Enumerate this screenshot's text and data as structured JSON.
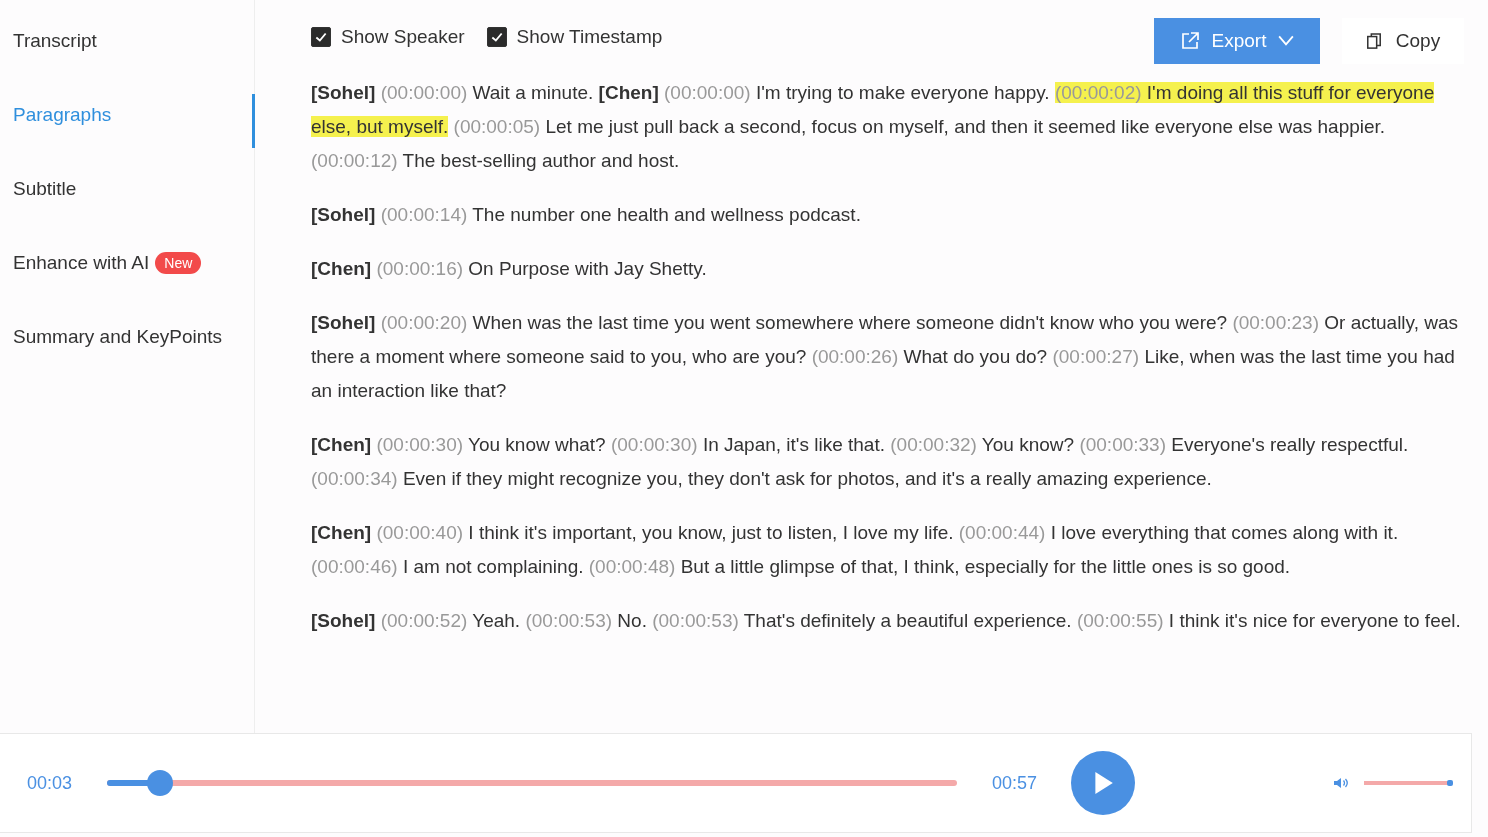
{
  "sidebar": {
    "items": [
      {
        "label": "Transcript",
        "selected": false
      },
      {
        "label": "Paragraphs",
        "selected": true
      },
      {
        "label": "Subtitle",
        "selected": false
      },
      {
        "label": "Enhance with AI",
        "selected": false,
        "badge": "New"
      },
      {
        "label": "Summary and KeyPoints",
        "selected": false
      }
    ]
  },
  "toolbar": {
    "options": [
      {
        "label": "Show Speaker",
        "checked": true
      },
      {
        "label": "Show Timestamp",
        "checked": true
      }
    ],
    "export_button": "Export",
    "copy_button": "Copy"
  },
  "paragraphs": [
    {
      "segments": [
        {
          "speaker": "[Sohel]",
          "time": "(00:00:00)",
          "text": "Wait a minute.",
          "highlighted": false
        },
        {
          "speaker": "[Chen]",
          "time": "(00:00:00)",
          "text": "I'm trying to make everyone happy.",
          "highlighted": false
        },
        {
          "time": "(00:00:02)",
          "text": "I'm doing all this stuff for everyone else, but myself.",
          "highlighted": true
        },
        {
          "time": "(00:00:05)",
          "text": "Let me just pull back a second, focus on myself, and then it seemed like everyone else was happier.",
          "highlighted": false
        },
        {
          "time": "(00:00:12)",
          "text": "The best-selling author and host.",
          "highlighted": false
        }
      ]
    },
    {
      "segments": [
        {
          "speaker": "[Sohel]",
          "time": "(00:00:14)",
          "text": "The number one health and wellness podcast.",
          "highlighted": false
        }
      ]
    },
    {
      "segments": [
        {
          "speaker": "[Chen]",
          "time": "(00:00:16)",
          "text": "On Purpose with Jay Shetty.",
          "highlighted": false
        }
      ]
    },
    {
      "segments": [
        {
          "speaker": "[Sohel]",
          "time": "(00:00:20)",
          "text": "When was the last time you went somewhere where someone didn't know who you were?",
          "highlighted": false
        },
        {
          "time": "(00:00:23)",
          "text": "Or actually, was there a moment where someone said to you, who are you?",
          "highlighted": false
        },
        {
          "time": "(00:00:26)",
          "text": "What do you do?",
          "highlighted": false
        },
        {
          "time": "(00:00:27)",
          "text": "Like, when was the last time you had an interaction like that?",
          "highlighted": false
        }
      ]
    },
    {
      "segments": [
        {
          "speaker": "[Chen]",
          "time": "(00:00:30)",
          "text": "You know what?",
          "highlighted": false
        },
        {
          "time": "(00:00:30)",
          "text": "In Japan, it's like that.",
          "highlighted": false
        },
        {
          "time": "(00:00:32)",
          "text": "You know?",
          "highlighted": false
        },
        {
          "time": "(00:00:33)",
          "text": "Everyone's really respectful.",
          "highlighted": false
        },
        {
          "time": "(00:00:34)",
          "text": "Even if they might recognize you, they don't ask for photos, and it's a really amazing experience.",
          "highlighted": false
        }
      ]
    },
    {
      "segments": [
        {
          "speaker": "[Chen]",
          "time": "(00:00:40)",
          "text": "I think it's important, you know, just to listen, I love my life.",
          "highlighted": false
        },
        {
          "time": "(00:00:44)",
          "text": "I love everything that comes along with it.",
          "highlighted": false
        },
        {
          "time": "(00:00:46)",
          "text": "I am not complaining.",
          "highlighted": false
        },
        {
          "time": "(00:00:48)",
          "text": "But a little glimpse of that, I think, especially for the little ones is so good.",
          "highlighted": false
        }
      ]
    },
    {
      "segments": [
        {
          "speaker": "[Sohel]",
          "time": "(00:00:52)",
          "text": "Yeah.",
          "highlighted": false
        },
        {
          "time": "(00:00:53)",
          "text": "No.",
          "highlighted": false
        },
        {
          "time": "(00:00:53)",
          "text": "That's definitely a beautiful experience.",
          "highlighted": false
        },
        {
          "time": "(00:00:55)",
          "text": "I think it's nice for everyone to feel.",
          "highlighted": false
        }
      ]
    }
  ],
  "player": {
    "current_time": "00:03",
    "level": 0.06,
    "duration": "00:57",
    "volume": {
      "level": 0.95
    }
  }
}
